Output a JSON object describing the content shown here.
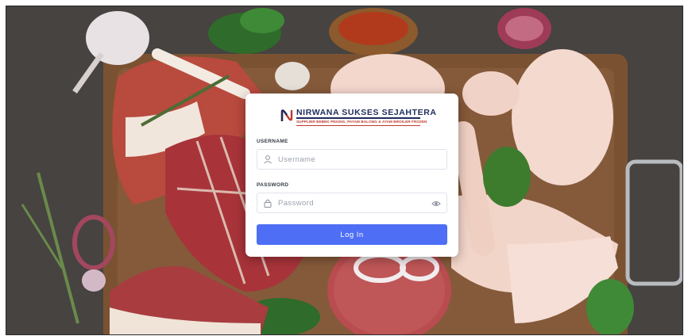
{
  "brand": {
    "name": "NIRWANA SUKSES SEJAHTERA",
    "tagline": "SUPPLIER BEBEK PEKING, PAYAM BALONG & AYAM BROILER FROZEN"
  },
  "form": {
    "username_label": "USERNAME",
    "username_placeholder": "Username",
    "password_label": "PASSWORD",
    "password_placeholder": "Password",
    "login_label": "Log In"
  },
  "colors": {
    "accent": "#4d6ef5",
    "brand_navy": "#1f2b5c",
    "brand_red": "#c0392b"
  },
  "icons": {
    "username": "user-icon",
    "password": "lock-icon",
    "toggle": "eye-icon"
  }
}
